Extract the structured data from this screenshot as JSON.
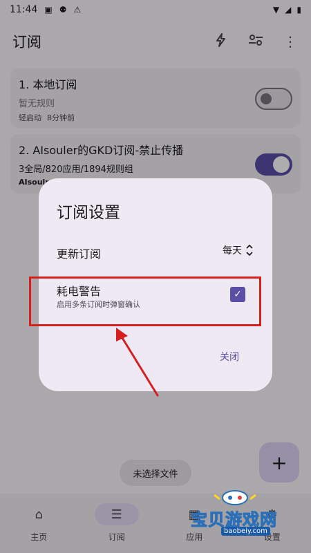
{
  "status_bar": {
    "time": "11:44"
  },
  "app_bar": {
    "title": "订阅"
  },
  "subscriptions": [
    {
      "title": "1. 本地订阅",
      "subtitle": "暂无规则",
      "meta1": "轻启动",
      "meta2": "8分钟前",
      "enabled": false
    },
    {
      "title": "2. AIsouler的GKD订阅-禁止传播",
      "subtitle": "3全局/820应用/1894规则组",
      "meta1": "AIsoulr",
      "meta2": "",
      "enabled": true
    }
  ],
  "dialog": {
    "title": "订阅设置",
    "update_label": "更新订阅",
    "update_value": "每天",
    "warn_title": "耗电警告",
    "warn_desc": "启用多条订阅时弹窗确认",
    "warn_checked": true,
    "close_label": "关闭"
  },
  "snackbar": {
    "text": "未选择文件"
  },
  "bottom_nav": [
    {
      "label": "主页",
      "icon": "home-icon"
    },
    {
      "label": "订阅",
      "icon": "list-icon"
    },
    {
      "label": "应用",
      "icon": "apps-icon"
    },
    {
      "label": "设置",
      "icon": "settings-icon"
    }
  ],
  "watermark": {
    "text": "宝贝游戏网",
    "url": "baobeiy.com"
  },
  "colors": {
    "accent": "#5a4fa8",
    "annotation": "#d62020"
  }
}
